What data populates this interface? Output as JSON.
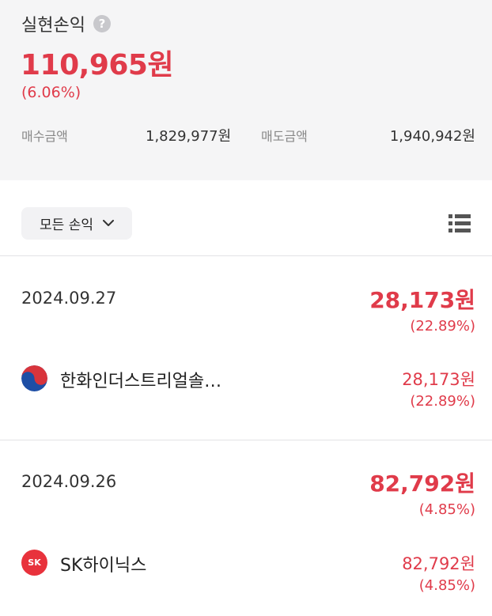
{
  "summary": {
    "title": "실현손익",
    "help_symbol": "?",
    "total_profit": "110,965원",
    "total_rate": "(6.06%)",
    "buy_label": "매수금액",
    "buy_amount": "1,829,977원",
    "sell_label": "매도금액",
    "sell_amount": "1,940,942원"
  },
  "toolbar": {
    "filter_label": "모든 손익",
    "filter_icon": "chevron-down-icon",
    "view_icon": "list-view-icon"
  },
  "colors": {
    "profit": "#e03b4a",
    "summary_bg": "#f5f5f6"
  },
  "groups": [
    {
      "date": "2024.09.27",
      "amount": "28,173원",
      "rate": "(22.89%)",
      "items": [
        {
          "name": "한화인더스트리얼솔…",
          "logo_icon": "korea-flag-icon",
          "amount": "28,173원",
          "rate": "(22.89%)"
        }
      ]
    },
    {
      "date": "2024.09.26",
      "amount": "82,792원",
      "rate": "(4.85%)",
      "items": [
        {
          "name": "SK하이닉스",
          "logo_icon": "sk-logo-icon",
          "logo_text": "SK",
          "amount": "82,792원",
          "rate": "(4.85%)"
        }
      ]
    }
  ]
}
